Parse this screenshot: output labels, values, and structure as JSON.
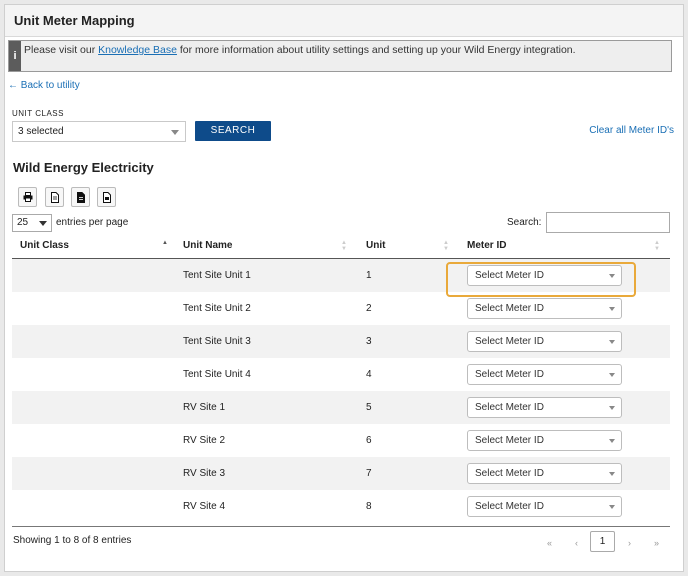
{
  "header": {
    "title": "Unit Meter Mapping"
  },
  "notice": {
    "icon": "i",
    "text_before": "Please visit our ",
    "link": "Knowledge Base",
    "text_after": " for more information about utility settings and setting up your Wild Energy integration."
  },
  "back_link": "← Back to utility",
  "filter": {
    "label": "UNIT CLASS",
    "selected": "3 selected",
    "search_button": "SEARCH",
    "clear_link": "Clear all Meter ID's"
  },
  "section": {
    "title": "Wild Energy Electricity"
  },
  "export_buttons": [
    "print-icon",
    "csv-icon",
    "excel-icon",
    "pdf-icon"
  ],
  "table_controls": {
    "page_size": "25",
    "entries_label": "entries per page",
    "search_label": "Search:"
  },
  "table": {
    "columns": [
      "Unit Class",
      "Unit Name",
      "Unit",
      "Meter ID"
    ],
    "rows": [
      {
        "unit_class": "",
        "unit_name": "Tent Site Unit 1",
        "unit": "1",
        "meter_id": "Select Meter ID"
      },
      {
        "unit_class": "",
        "unit_name": "Tent Site Unit 2",
        "unit": "2",
        "meter_id": "Select Meter ID"
      },
      {
        "unit_class": "",
        "unit_name": "Tent Site Unit 3",
        "unit": "3",
        "meter_id": "Select Meter ID"
      },
      {
        "unit_class": "",
        "unit_name": "Tent Site Unit 4",
        "unit": "4",
        "meter_id": "Select Meter ID"
      },
      {
        "unit_class": "",
        "unit_name": "RV Site 1",
        "unit": "5",
        "meter_id": "Select Meter ID"
      },
      {
        "unit_class": "",
        "unit_name": "RV Site 2",
        "unit": "6",
        "meter_id": "Select Meter ID"
      },
      {
        "unit_class": "",
        "unit_name": "RV Site 3",
        "unit": "7",
        "meter_id": "Select Meter ID"
      },
      {
        "unit_class": "",
        "unit_name": "RV Site 4",
        "unit": "8",
        "meter_id": "Select Meter ID"
      }
    ]
  },
  "footer": {
    "info": "Showing 1 to 8 of 8 entries",
    "pagination": {
      "first": "«",
      "prev": "‹",
      "current": "1",
      "next": "›",
      "last": "»"
    }
  },
  "colors": {
    "primary_button": "#0e4b8a",
    "link": "#1a6fb5",
    "highlight": "#e9a93a",
    "stripe": "#f2f2f2"
  }
}
